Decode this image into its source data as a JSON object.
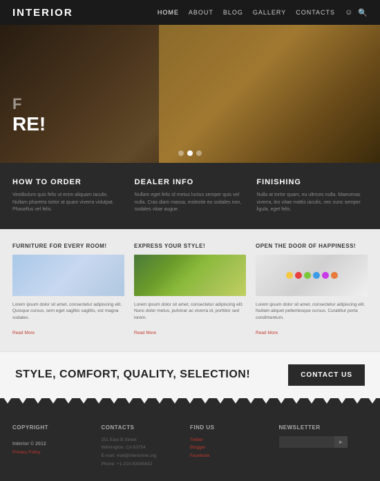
{
  "header": {
    "logo": "INTERIOR",
    "nav": {
      "items": [
        {
          "label": "HOME",
          "active": true
        },
        {
          "label": "ABOUT",
          "active": false
        },
        {
          "label": "BLOG",
          "active": false
        },
        {
          "label": "GALLERY",
          "active": false
        },
        {
          "label": "CONTACTS",
          "active": false
        }
      ]
    }
  },
  "hero": {
    "text_line1": "F",
    "text_line2": "RE!",
    "dots": [
      "",
      "",
      ""
    ]
  },
  "dark_section": {
    "columns": [
      {
        "title": "HOW TO ORDER",
        "body": "Vestibulum quis felis ut enim aliquam iaculis. Nullam pharetra tortor at quam viverra volutpat. Phasellus vel felis."
      },
      {
        "title": "DEALER INFO",
        "body": "Nullam eget felis id metus luctus semper quis vel nulla. Cras diam massa, molestie eu sodales non, sodales vitae augue."
      },
      {
        "title": "FINISHING",
        "body": "Nulla at tortor quam, eu ultrices nulla. Maecenas viverra, leo vitae mattis iaculis, nec nunc semper ligula, eget felis."
      }
    ]
  },
  "features": {
    "columns": [
      {
        "title": "FURNITURE FOR EVERY ROOM!",
        "body": "Lorem ipsum dolor sit amet, consectetur adipiscing elit. Quisque cursus, sem eget sagittis sagittis, est magna sodales.",
        "read_more": "Read More"
      },
      {
        "title": "EXPRESS YOUR STYLE!",
        "body": "Lorem ipsum dolor sit amet, consectetur adipiscing elit. Nunc dolor metus, pulvinar ac viverra id, porttitor sed lorem.",
        "read_more": "Read More"
      },
      {
        "title": "OPEN THE DOOR OF HAPPINESS!",
        "body": "Lorem ipsum dolor sit amet, consectetur adipiscing elit. Nullam aliquet pellentesque cursus. Curabitur porta condimentum.",
        "read_more": "Read More"
      }
    ],
    "balls": [
      "#f5c842",
      "#e84040",
      "#7ac83a",
      "#3a9ae8",
      "#c83ae8",
      "#e87a3a"
    ]
  },
  "cta": {
    "text": "STYLE, COMFORT, QUALITY, SELECTION!",
    "button": "CONTACT US"
  },
  "footer": {
    "copyright_title": "Copyright",
    "brand": "Interior © 2012",
    "privacy": "Privacy Policy",
    "contacts_title": "Contacts",
    "address": "251 East B Street\nWilmington, CA 63754",
    "email": "E-mail: mail@interiorink.org",
    "phone": "Phone: +1-210-83045632",
    "find_us_title": "Find Us",
    "social_links": [
      "Twitter",
      "Blogger",
      "Facebook"
    ],
    "newsletter_title": "Newsletter",
    "newsletter_placeholder": ""
  }
}
